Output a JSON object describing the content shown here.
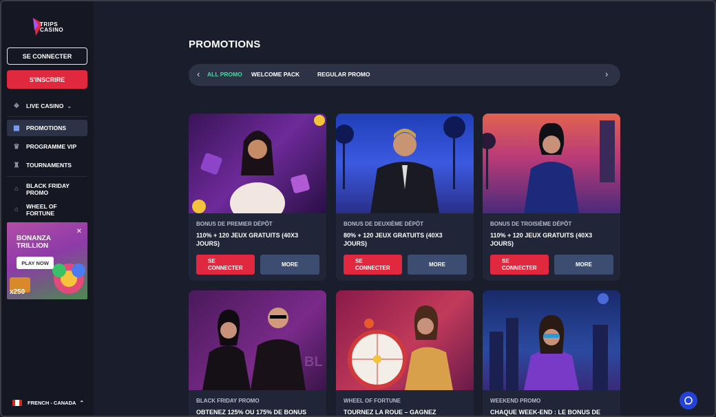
{
  "brand": {
    "name_line1": "TRIPS",
    "name_line2": "CASINO"
  },
  "auth": {
    "login_label": "SE CONNECTER",
    "signup_label": "S'INSCRIRE"
  },
  "nav": {
    "live_casino": "LIVE CASINO",
    "items": [
      {
        "label": "PROMOTIONS",
        "icon": "gift-icon"
      },
      {
        "label": "PROGRAMME VIP",
        "icon": "crown-icon"
      },
      {
        "label": "TOURNAMENTS",
        "icon": "trophy-icon"
      },
      {
        "label_1": "BLACK FRIDAY",
        "label_2": "PROMO",
        "icon": "tag-icon"
      },
      {
        "label_1": "WHEEL OF",
        "label_2": "FORTUNE",
        "icon": "tag-icon"
      }
    ]
  },
  "banner": {
    "title": "BONANZA TRILLION",
    "cta": "PLAY NOW",
    "badge": "x250"
  },
  "language": "FRENCH - CANADA",
  "page": {
    "title": "PROMOTIONS"
  },
  "tabs": [
    "ALL PROMO",
    "WELCOME PACK",
    "REGULAR PROMO"
  ],
  "cards": [
    {
      "category": "BONUS DE PREMIER DÉPÔT",
      "text": "110% + 120 JEUX GRATUITS (40X3 JOURS)",
      "btn_login_1": "SE",
      "btn_login_2": "CONNECTER",
      "btn_more": "MORE"
    },
    {
      "category": "BONUS DE DEUXIÈME DÉPÔT",
      "text": "80% + 120 JEUX GRATUITS (40X3 JOURS)",
      "btn_login_1": "SE",
      "btn_login_2": "CONNECTER",
      "btn_more": "MORE"
    },
    {
      "category": "BONUS DE TROISIÈME DÉPÔT",
      "text": "110% + 120 JEUX GRATUITS (40X3 JOURS)",
      "btn_login_1": "SE",
      "btn_login_2": "CONNECTER",
      "btn_more": "MORE"
    },
    {
      "category": "BLACK FRIDAY PROMO",
      "text": "OBTENEZ 125% OU 175% DE BONUS"
    },
    {
      "category": "WHEEL OF FORTUNE",
      "text": "TOURNEZ LA ROUE – GAGNEZ"
    },
    {
      "category": "WEEKEND PROMO",
      "text": "CHAQUE WEEK-END : LE BONUS DE"
    }
  ],
  "colors": {
    "accent_green": "#4fd6a4",
    "signup_red": "#e0283e",
    "more_blue": "#3d4d72",
    "chat_blue": "#2443d6"
  }
}
